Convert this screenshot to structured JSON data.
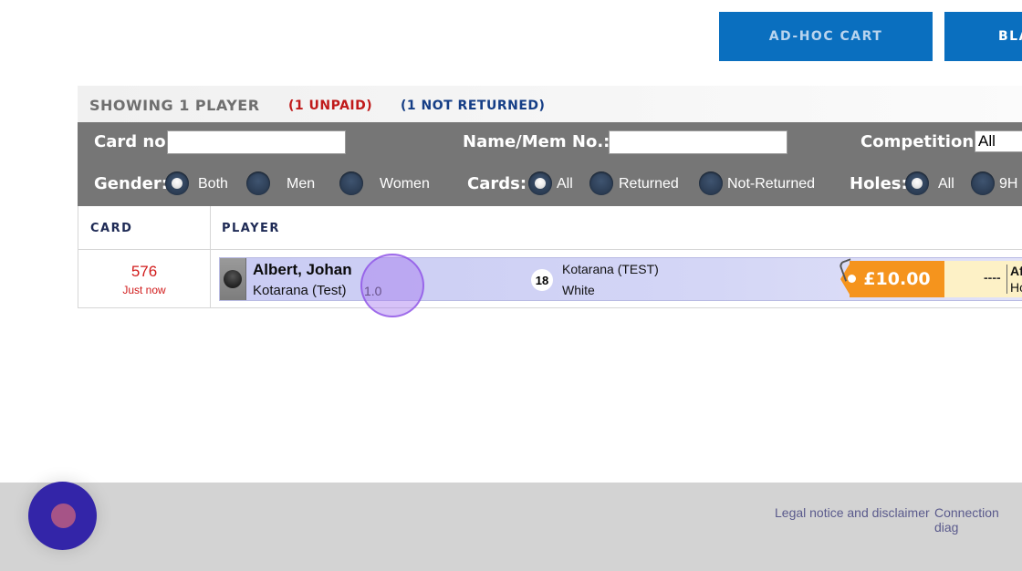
{
  "top_buttons": {
    "adhoc_label": "AD-HOC CART",
    "second_label": "BLA"
  },
  "summary": {
    "showing": "SHOWING 1 PLAYER",
    "unpaid": "(1 UNPAID)",
    "not_returned": "(1 NOT RETURNED)"
  },
  "filters": {
    "card_no_label": "Card no:",
    "card_no_value": "",
    "name_label": "Name/Mem No.:",
    "name_value": "",
    "competition_label": "Competition:",
    "competition_value": "All",
    "gender_label": "Gender:",
    "gender_options": [
      "Both",
      "Men",
      "Women"
    ],
    "gender_selected": "Both",
    "cards_label": "Cards:",
    "cards_options": [
      "All",
      "Returned",
      "Not-Returned"
    ],
    "cards_selected": "All",
    "holes_label": "Holes:",
    "holes_options": [
      "All",
      "9H"
    ],
    "holes_selected": "All"
  },
  "table": {
    "columns": [
      "CARD",
      "PLAYER"
    ],
    "rows": [
      {
        "card_number": "576",
        "card_time": "Just now",
        "player_name": "Albert, Johan",
        "club": "Kotarana (Test)",
        "handicap": "1.0",
        "holes": "18",
        "competition": "Kotarana (TEST)",
        "tee": "White",
        "price": "£10.00",
        "status_dash": "----",
        "status_line1": "Af",
        "status_line2": "Ho"
      }
    ]
  },
  "footer": {
    "legal": "Legal notice and disclaimer",
    "connection": "Connection diag"
  },
  "colors": {
    "button_blue": "#0a6fbf",
    "filter_gray": "#767676",
    "unpaid_red": "#c01a1a",
    "not_returned_blue": "#153e86",
    "price_orange": "#f5941d",
    "fab_purple": "#3325a8"
  }
}
